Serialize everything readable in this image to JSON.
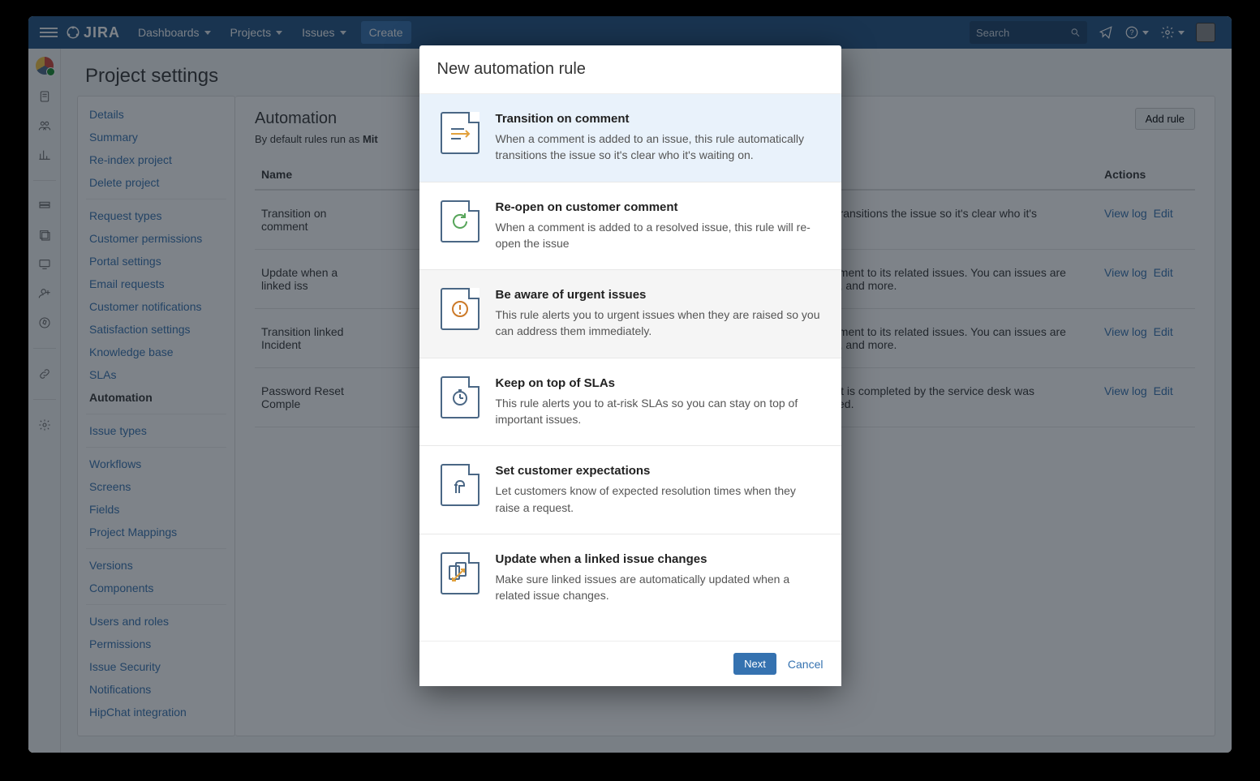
{
  "topbar": {
    "logo": "JIRA",
    "nav": {
      "dashboards": "Dashboards",
      "projects": "Projects",
      "issues": "Issues",
      "create": "Create"
    },
    "search_placeholder": "Search"
  },
  "page_title": "Project settings",
  "sidebar": {
    "groups": [
      [
        "Details",
        "Summary",
        "Re-index project",
        "Delete project"
      ],
      [
        "Request types",
        "Customer permissions",
        "Portal settings",
        "Email requests",
        "Customer notifications",
        "Satisfaction settings",
        "Knowledge base",
        "SLAs",
        "Automation"
      ],
      [
        "Issue types"
      ],
      [
        "Workflows",
        "Screens",
        "Fields",
        "Project Mappings"
      ],
      [
        "Versions",
        "Components"
      ],
      [
        "Users and roles",
        "Permissions",
        "Issue Security",
        "Notifications",
        "HipChat integration"
      ]
    ],
    "active": "Automation"
  },
  "main": {
    "title": "Automation",
    "subtitle_prefix": "By default rules run as ",
    "subtitle_bold": "Mit",
    "add_rule_label": "Add rule",
    "columns": {
      "name": "Name",
      "actions": "Actions"
    },
    "rows": [
      {
        "name": "Transition on comment",
        "desc": "atically transitions the issue so it's clear who it's",
        "view": "View log",
        "edit": "Edit"
      },
      {
        "name": "Update when a linked iss",
        "desc": "d a comment to its related issues. You can issues are updated, and more.",
        "view": "View log",
        "edit": "Edit"
      },
      {
        "name": "Transition linked Incident",
        "desc": "d a comment to its related issues. You can issues are updated, and more.",
        "view": "View log",
        "edit": "Edit"
      },
      {
        "name": "Password Reset Comple",
        "desc": "icket that is completed by the service desk was completed.",
        "view": "View log",
        "edit": "Edit"
      }
    ]
  },
  "modal": {
    "title": "New automation rule",
    "templates": [
      {
        "title": "Transition on comment",
        "desc": "When a comment is added to an issue, this rule automatically transitions the issue so it's clear who it's waiting on.",
        "state": "selected"
      },
      {
        "title": "Re-open on customer comment",
        "desc": "When a comment is added to a resolved issue, this rule will re-open the issue",
        "state": ""
      },
      {
        "title": "Be aware of urgent issues",
        "desc": "This rule alerts you to urgent issues when they are raised so you can address them immediately.",
        "state": "hover"
      },
      {
        "title": "Keep on top of SLAs",
        "desc": "This rule alerts you to at-risk SLAs so you can stay on top of important issues.",
        "state": ""
      },
      {
        "title": "Set customer expectations",
        "desc": "Let customers know of expected resolution times when they raise a request.",
        "state": ""
      },
      {
        "title": "Update when a linked issue changes",
        "desc": "Make sure linked issues are automatically updated when a related issue changes.",
        "state": ""
      }
    ],
    "next": "Next",
    "cancel": "Cancel"
  }
}
